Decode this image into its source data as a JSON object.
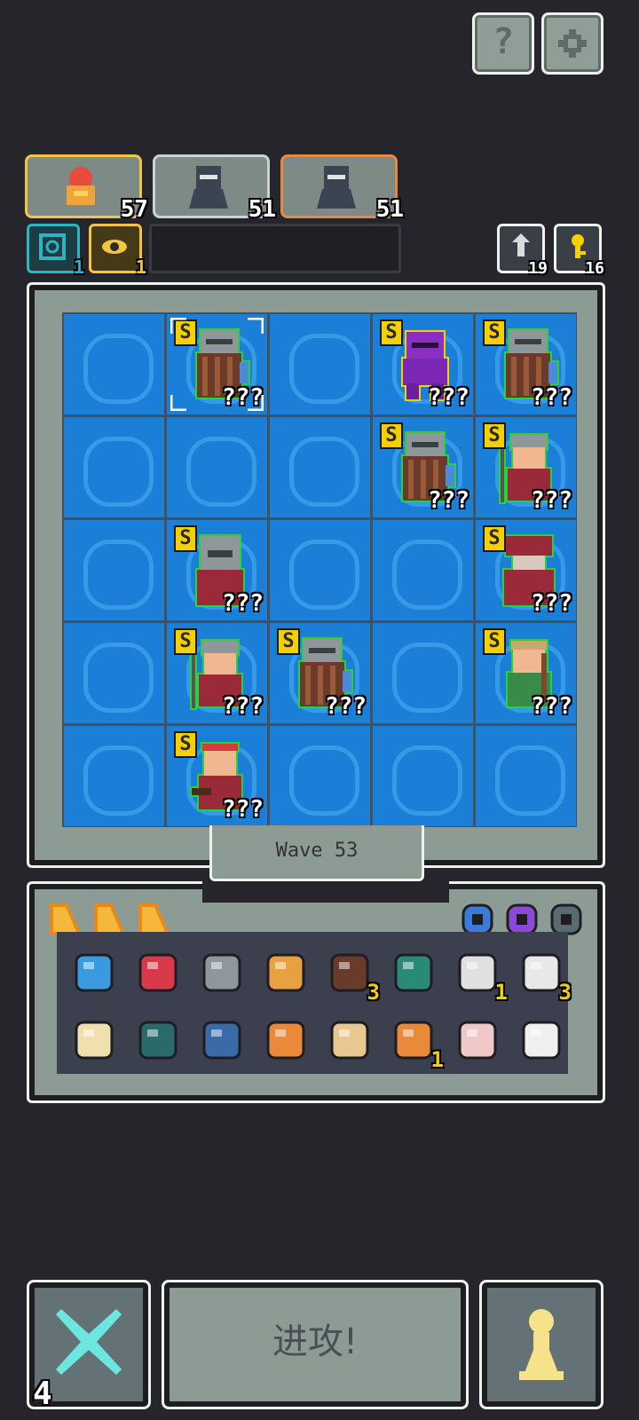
{
  "top_buttons": {
    "help_label": "?",
    "settings_icon": "gear-icon"
  },
  "heroes": [
    {
      "icon": "bell-hero-icon",
      "level": "57",
      "border": "#f5c542"
    },
    {
      "icon": "ninja-hero-icon",
      "level": "51",
      "border": "#c9d3d0"
    },
    {
      "icon": "ninja-hero-icon",
      "level": "51",
      "border": "#e98843"
    }
  ],
  "relics": [
    {
      "icon": "target-icon",
      "count": "1",
      "border": "#2ab5c4"
    },
    {
      "icon": "eye-icon",
      "count": "1",
      "border": "#f5c542"
    }
  ],
  "resources": [
    {
      "icon": "reroll-icon",
      "count": "19"
    },
    {
      "icon": "key-icon",
      "count": "16"
    }
  ],
  "board": {
    "rows": 5,
    "cols": 5,
    "units": [
      {
        "row": 0,
        "col": 1,
        "rank": "S",
        "stat": "???",
        "kind": "shield-knight",
        "outline": "#2ad13f",
        "selected": true
      },
      {
        "row": 0,
        "col": 3,
        "rank": "S",
        "stat": "???",
        "kind": "purple-knight",
        "outline": "#f5d000"
      },
      {
        "row": 0,
        "col": 4,
        "rank": "S",
        "stat": "???",
        "kind": "shield-knight",
        "outline": "#2ad13f"
      },
      {
        "row": 1,
        "col": 3,
        "rank": "S",
        "stat": "???",
        "kind": "shield-knight",
        "outline": "#2ad13f"
      },
      {
        "row": 1,
        "col": 4,
        "rank": "S",
        "stat": "???",
        "kind": "spear-soldier",
        "outline": "#2ad13f"
      },
      {
        "row": 2,
        "col": 1,
        "rank": "S",
        "stat": "???",
        "kind": "helmet-knight",
        "outline": "#2ad13f"
      },
      {
        "row": 2,
        "col": 4,
        "rank": "S",
        "stat": "???",
        "kind": "red-mage",
        "outline": "#2ad13f"
      },
      {
        "row": 3,
        "col": 1,
        "rank": "S",
        "stat": "???",
        "kind": "spear-soldier",
        "outline": "#2ad13f"
      },
      {
        "row": 3,
        "col": 2,
        "rank": "S",
        "stat": "???",
        "kind": "shield-knight",
        "outline": "#2ad13f"
      },
      {
        "row": 3,
        "col": 4,
        "rank": "S",
        "stat": "???",
        "kind": "archer",
        "outline": "#2ad13f"
      },
      {
        "row": 4,
        "col": 1,
        "rank": "S",
        "stat": "???",
        "kind": "headband-fighter",
        "outline": "#2ad13f"
      }
    ]
  },
  "wave_label": "Wave  53",
  "inventory": {
    "upgrades": [
      "triangle-gem-icon",
      "triangle-gem-icon",
      "triangle-gem-icon"
    ],
    "filters": [
      "ring-icon",
      "crystal-icon",
      "armor-icon"
    ],
    "items": [
      {
        "icon": "blue-gem-ring-icon",
        "count": ""
      },
      {
        "icon": "red-gem-ring-icon",
        "count": ""
      },
      {
        "icon": "hammer-icon",
        "count": ""
      },
      {
        "icon": "ship-icon",
        "count": ""
      },
      {
        "icon": "telescope-icon",
        "count": "3"
      },
      {
        "icon": "altar-icon",
        "count": ""
      },
      {
        "icon": "anvil-icon",
        "count": "1"
      },
      {
        "icon": "bone-icon",
        "count": "3"
      },
      {
        "icon": "battle-axe-icon",
        "count": ""
      },
      {
        "icon": "cauldron-icon",
        "count": ""
      },
      {
        "icon": "mirror-icon",
        "count": ""
      },
      {
        "icon": "baguette-icon",
        "count": ""
      },
      {
        "icon": "scroll-icon",
        "count": ""
      },
      {
        "icon": "bell-icon",
        "count": "1"
      },
      {
        "icon": "paper-roll-icon",
        "count": ""
      },
      {
        "icon": "potion-icon",
        "count": ""
      }
    ]
  },
  "bottom": {
    "cancel_count": "4",
    "attack_label": "进攻!",
    "pawn_icon": "pawn-icon"
  },
  "colors": {
    "tile": "#1b7fd8",
    "frame": "#8c9b94",
    "accent": "#f5d000"
  }
}
